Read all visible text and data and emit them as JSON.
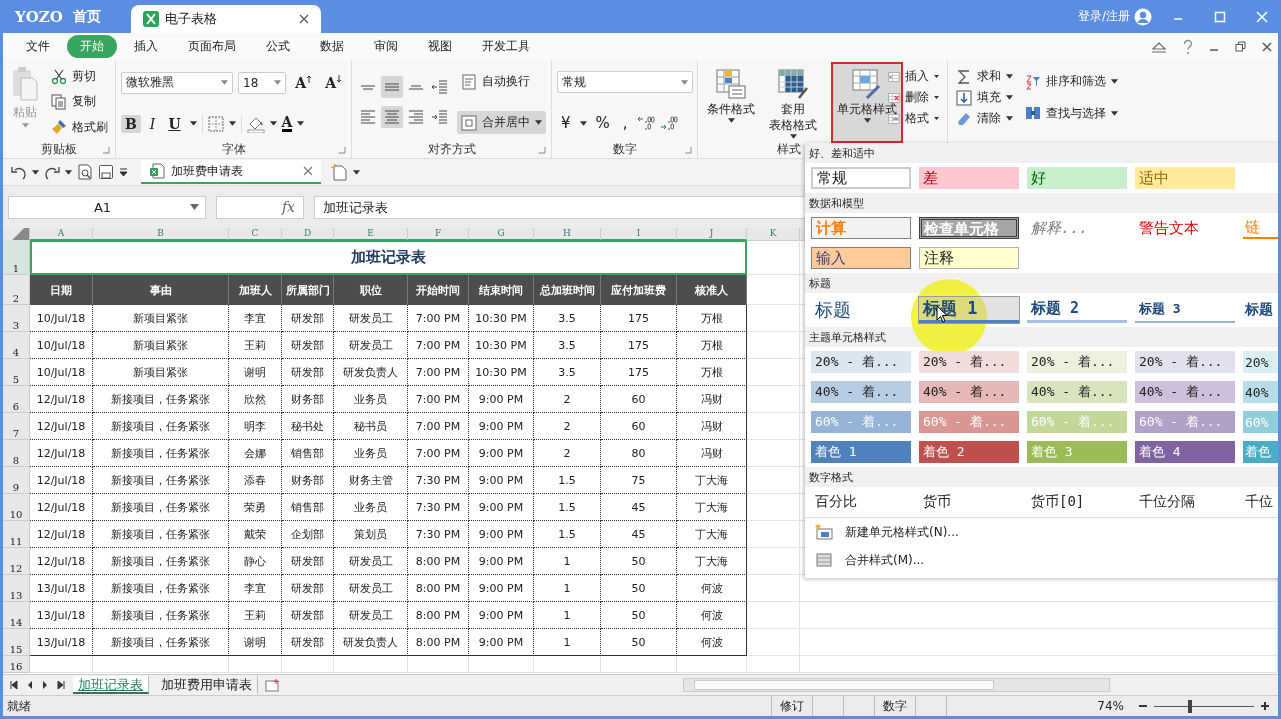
{
  "title_bar": {
    "logo": "YOZO",
    "home": "首页",
    "tab": "电子表格",
    "account": "登录/注册"
  },
  "menu": [
    {
      "label": "文件",
      "selected": false
    },
    {
      "label": "开始",
      "selected": true
    },
    {
      "label": "插入",
      "selected": false
    },
    {
      "label": "页面布局",
      "selected": false
    },
    {
      "label": "公式",
      "selected": false
    },
    {
      "label": "数据",
      "selected": false
    },
    {
      "label": "审阅",
      "selected": false
    },
    {
      "label": "视图",
      "selected": false
    },
    {
      "label": "开发工具",
      "selected": false
    }
  ],
  "ribbon": {
    "clipboard": {
      "paste": {
        "label": "粘贴",
        "disabled": true
      },
      "actions": [
        {
          "kind": "cut",
          "label": "剪切"
        },
        {
          "kind": "copy",
          "label": "复制"
        },
        {
          "kind": "brush",
          "label": "格式刷"
        }
      ],
      "label": "剪贴板"
    },
    "font": {
      "family": "微软雅黑",
      "size": "18",
      "size_buttons": [
        {
          "kind": "grow",
          "label": "A"
        },
        {
          "kind": "shrink",
          "label": "A"
        }
      ],
      "styles": [
        {
          "label": "B",
          "selected": true
        },
        {
          "label": "I",
          "selected": false
        },
        {
          "label": "U",
          "selected": false
        }
      ],
      "color_button": "A",
      "label": "字体"
    },
    "alignment": {
      "buttons": [
        {
          "kind": "top",
          "selected": false
        },
        {
          "kind": "middle",
          "selected": true
        },
        {
          "kind": "bottom",
          "selected": false
        },
        {
          "kind": "outdent",
          "selected": false
        },
        {
          "kind": "left",
          "selected": false
        },
        {
          "kind": "center",
          "selected": true
        },
        {
          "kind": "right",
          "selected": false
        },
        {
          "kind": "indent",
          "selected": false
        }
      ],
      "wrap": {
        "label": "自动换行",
        "selected": false
      },
      "merge": {
        "label": "合并居中",
        "selected": true
      },
      "label": "对齐方式"
    },
    "number": {
      "format": "常规",
      "symbols": [
        "¥",
        "%",
        ","
      ],
      "label": "数字"
    },
    "styles": {
      "buttons": [
        {
          "kind": "conditional",
          "lines": [
            "条件格式"
          ],
          "selected": false
        },
        {
          "kind": "table",
          "lines": [
            "套用",
            "表格格式"
          ],
          "selected": false
        },
        {
          "kind": "cell",
          "lines": [
            "单元格样式"
          ],
          "selected": true
        }
      ],
      "label": "样式"
    },
    "cells": [
      {
        "kind": "insert",
        "label": "插入"
      },
      {
        "kind": "delete",
        "label": "删除"
      },
      {
        "kind": "format",
        "label": "格式"
      }
    ],
    "editing": [
      [
        {
          "kind": "sum",
          "label": "求和"
        },
        {
          "kind": "fill",
          "label": "填充"
        },
        {
          "kind": "clear",
          "label": "清除"
        }
      ],
      [
        {
          "kind": "sort",
          "label": "排序和筛选"
        },
        {
          "kind": "find",
          "label": "查找与选择"
        }
      ]
    ]
  },
  "document_tab": {
    "label": "加班费申请表"
  },
  "formula_bar": {
    "cell": "A1",
    "fx": "fx",
    "value": "加班记录表"
  },
  "sheet": {
    "columns": [
      {
        "label": "A",
        "selected": true
      },
      {
        "label": "B",
        "selected": true
      },
      {
        "label": "C",
        "selected": true
      },
      {
        "label": "D",
        "selected": true
      },
      {
        "label": "E",
        "selected": true
      },
      {
        "label": "F",
        "selected": true
      },
      {
        "label": "G",
        "selected": true
      },
      {
        "label": "H",
        "selected": true
      },
      {
        "label": "I",
        "selected": true
      },
      {
        "label": "J",
        "selected": true
      },
      {
        "label": "K",
        "selected": false
      }
    ],
    "rows": [
      {
        "label": "1",
        "selected": true
      },
      {
        "label": "2",
        "selected": false
      },
      {
        "label": "3",
        "selected": false
      },
      {
        "label": "4",
        "selected": false
      },
      {
        "label": "5",
        "selected": false
      },
      {
        "label": "6",
        "selected": false
      },
      {
        "label": "7",
        "selected": false
      },
      {
        "label": "8",
        "selected": false
      },
      {
        "label": "9",
        "selected": false
      },
      {
        "label": "10",
        "selected": false
      },
      {
        "label": "11",
        "selected": false
      },
      {
        "label": "12",
        "selected": false
      },
      {
        "label": "13",
        "selected": false
      },
      {
        "label": "14",
        "selected": false
      },
      {
        "label": "15",
        "selected": false
      },
      {
        "label": "16",
        "selected": false
      }
    ],
    "title": "加班记录表",
    "headers": [
      "日期",
      "事由",
      "加班人",
      "所属部门",
      "职位",
      "开始时间",
      "结束时间",
      "总加班时间",
      "应付加班费",
      "核准人"
    ],
    "data": [
      [
        "10/Jul/18",
        "新项目紧张",
        "李宜",
        "研发部",
        "研发员工",
        "7:00 PM",
        "10:30 PM",
        "3.5",
        "175",
        "万根"
      ],
      [
        "10/Jul/18",
        "新项目紧张",
        "王莉",
        "研发部",
        "研发员工",
        "7:00 PM",
        "10:30 PM",
        "3.5",
        "175",
        "万根"
      ],
      [
        "10/Jul/18",
        "新项目紧张",
        "谢明",
        "研发部",
        "研发负责人",
        "7:00 PM",
        "10:30 PM",
        "3.5",
        "175",
        "万根"
      ],
      [
        "12/Jul/18",
        "新接项目，任务紧张",
        "欣然",
        "财务部",
        "业务员",
        "7:00 PM",
        "9:00 PM",
        "2",
        "60",
        "冯财"
      ],
      [
        "12/Jul/18",
        "新接项目，任务紧张",
        "明李",
        "秘书处",
        "秘书员",
        "7:00 PM",
        "9:00 PM",
        "2",
        "60",
        "冯财"
      ],
      [
        "12/Jul/18",
        "新接项目，任务紧张",
        "会娜",
        "销售部",
        "业务员",
        "7:00 PM",
        "9:00 PM",
        "2",
        "80",
        "冯财"
      ],
      [
        "12/Jul/18",
        "新接项目，任务紧张",
        "添春",
        "财务部",
        "财务主管",
        "7:30 PM",
        "9:00 PM",
        "1.5",
        "75",
        "丁大海"
      ],
      [
        "12/Jul/18",
        "新接项目，任务紧张",
        "荣勇",
        "销售部",
        "业务员",
        "7:30 PM",
        "9:00 PM",
        "1.5",
        "45",
        "丁大海"
      ],
      [
        "12/Jul/18",
        "新接项目，任务紧张",
        "戴荣",
        "企划部",
        "策划员",
        "7:30 PM",
        "9:00 PM",
        "1.5",
        "45",
        "丁大海"
      ],
      [
        "12/Jul/18",
        "新接项目，任务紧张",
        "静心",
        "研发部",
        "研发员工",
        "8:00 PM",
        "9:00 PM",
        "1",
        "50",
        "丁大海"
      ],
      [
        "13/Jul/18",
        "新接项目，任务紧张",
        "李宜",
        "研发部",
        "研发员工",
        "8:00 PM",
        "9:00 PM",
        "1",
        "50",
        "何波"
      ],
      [
        "13/Jul/18",
        "新接项目，任务紧张",
        "王莉",
        "研发部",
        "研发员工",
        "8:00 PM",
        "9:00 PM",
        "1",
        "50",
        "何波"
      ],
      [
        "13/Jul/18",
        "新接项目，任务紧张",
        "谢明",
        "研发部",
        "研发负责人",
        "8:00 PM",
        "9:00 PM",
        "1",
        "50",
        "何波"
      ]
    ]
  },
  "sheet_tabs": [
    {
      "label": "加班记录表",
      "selected": true
    },
    {
      "label": "加班费用申请表",
      "selected": false
    }
  ],
  "status_bar": {
    "state": "就绪",
    "indicators": [
      "修订",
      "数字"
    ],
    "zoom": "74%",
    "zoom_slider": {
      "level": 0.36
    }
  },
  "cell_styles": {
    "sections": [
      {
        "title": "好、差和适中",
        "rows": [
          [
            {
              "label": "常规",
              "kind": "normal",
              "selected": false
            },
            {
              "label": "差",
              "kind": "bad",
              "selected": false
            },
            {
              "label": "好",
              "kind": "good",
              "selected": false
            },
            {
              "label": "适中",
              "kind": "neutral",
              "selected": false
            }
          ]
        ]
      },
      {
        "title": "数据和模型",
        "rows": [
          [
            {
              "label": "计算",
              "kind": "calc",
              "selected": false
            },
            {
              "label": "检查单元格",
              "kind": "check",
              "selected": false
            },
            {
              "label": "解释...",
              "kind": "explain",
              "selected": false
            },
            {
              "label": "警告文本",
              "kind": "warning",
              "selected": false
            },
            {
              "label": "链",
              "kind": "link",
              "selected": false
            }
          ],
          [
            {
              "label": "输入",
              "kind": "input",
              "selected": false
            },
            {
              "label": "注释",
              "kind": "note",
              "selected": false
            }
          ]
        ]
      },
      {
        "title": "标题",
        "rows": [
          [
            {
              "label": "标题",
              "kind": "title",
              "selected": false
            },
            {
              "label": "标题 1",
              "kind": "heading1",
              "selected": true
            },
            {
              "label": "标题 2",
              "kind": "heading2",
              "selected": false
            },
            {
              "label": "标题 3",
              "kind": "heading3",
              "selected": false
            },
            {
              "label": "标题",
              "kind": "heading4",
              "selected": false
            }
          ]
        ]
      },
      {
        "title": "主题单元格样式",
        "rows": [
          [
            {
              "label": "20% - 着...",
              "kind": "theme-light",
              "color": "#dce6f1",
              "selected": false
            },
            {
              "label": "20% - 着...",
              "kind": "theme-light",
              "color": "#f2dcdb",
              "selected": false
            },
            {
              "label": "20% - 着...",
              "kind": "theme-light",
              "color": "#ebf1de",
              "selected": false
            },
            {
              "label": "20% - 着...",
              "kind": "theme-light",
              "color": "#e4dfec",
              "selected": false
            },
            {
              "label": "20%",
              "kind": "theme-light",
              "color": "#daeef3",
              "selected": false
            }
          ],
          [
            {
              "label": "40% - 着...",
              "kind": "theme-light",
              "color": "#b8cce4",
              "selected": false
            },
            {
              "label": "40% - 着...",
              "kind": "theme-light",
              "color": "#e6b8b7",
              "selected": false
            },
            {
              "label": "40% - 着...",
              "kind": "theme-light",
              "color": "#d8e4bc",
              "selected": false
            },
            {
              "label": "40% - 着...",
              "kind": "theme-light",
              "color": "#ccc0da",
              "selected": false
            },
            {
              "label": "40%",
              "kind": "theme-light",
              "color": "#b7dee8",
              "selected": false
            }
          ],
          [
            {
              "label": "60% - 着...",
              "kind": "theme-dark",
              "color": "#95b3d7",
              "selected": false
            },
            {
              "label": "60% - 着...",
              "kind": "theme-dark",
              "color": "#da9694",
              "selected": false
            },
            {
              "label": "60% - 着...",
              "kind": "theme-dark",
              "color": "#c4d79b",
              "selected": false
            },
            {
              "label": "60% - 着...",
              "kind": "theme-dark",
              "color": "#b1a0c7",
              "selected": false
            },
            {
              "label": "60%",
              "kind": "theme-dark",
              "color": "#92cddc",
              "selected": false
            }
          ],
          [
            {
              "label": "着色 1",
              "kind": "theme-dark",
              "color": "#4f81bd",
              "selected": false
            },
            {
              "label": "着色 2",
              "kind": "theme-dark",
              "color": "#c0504d",
              "selected": false
            },
            {
              "label": "着色 3",
              "kind": "theme-dark",
              "color": "#9bbb59",
              "selected": false
            },
            {
              "label": "着色 4",
              "kind": "theme-dark",
              "color": "#8064a2",
              "selected": false
            },
            {
              "label": "着色",
              "kind": "theme-dark",
              "color": "#4bacc6",
              "selected": false
            }
          ]
        ]
      },
      {
        "title": "数字格式",
        "rows": [
          [
            {
              "label": "百分比",
              "kind": "plain",
              "selected": false
            },
            {
              "label": "货币",
              "kind": "plain",
              "selected": false
            },
            {
              "label": "货币[0]",
              "kind": "plain",
              "selected": false
            },
            {
              "label": "千位分隔",
              "kind": "plain",
              "selected": false
            },
            {
              "label": "千位",
              "kind": "plain",
              "selected": false
            }
          ]
        ]
      }
    ],
    "actions": [
      {
        "kind": "new",
        "label": "新建单元格样式(N)..."
      },
      {
        "kind": "merge",
        "label": "合并样式(M)..."
      }
    ]
  }
}
